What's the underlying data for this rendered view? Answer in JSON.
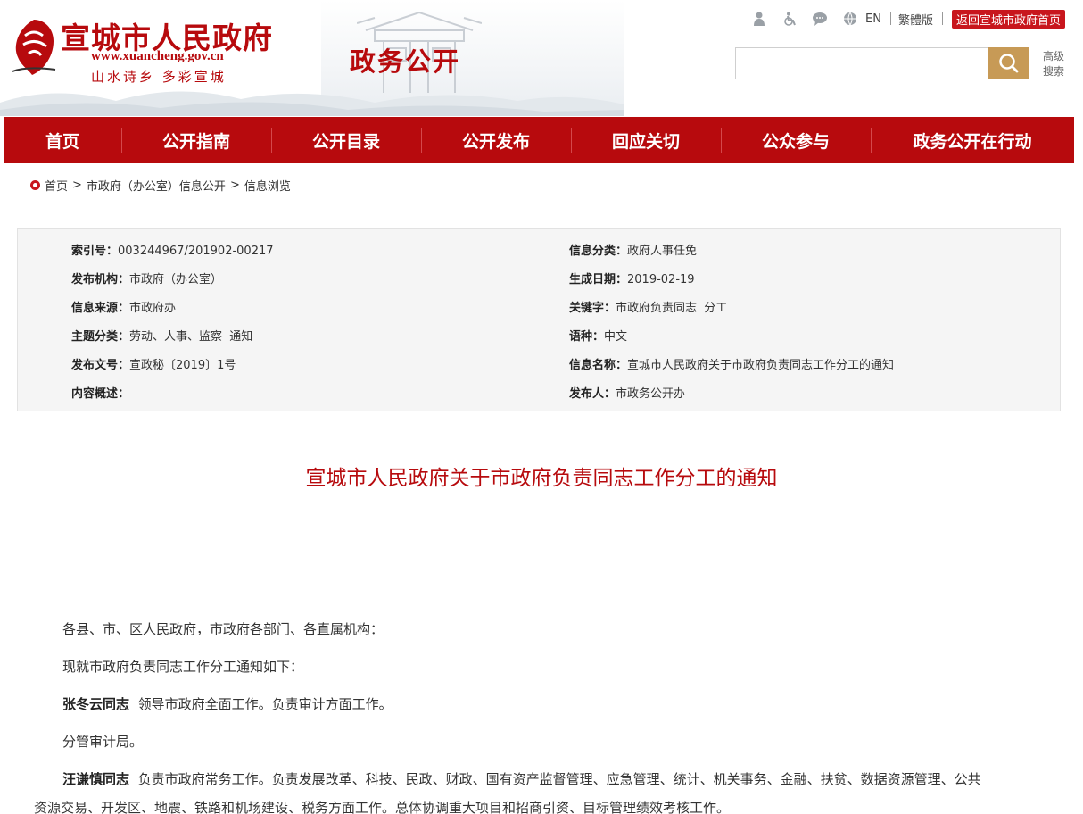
{
  "header": {
    "site_title": "宣城市人民政府",
    "site_url": "www.xuancheng.gov.cn",
    "slogan": "山水诗乡 多彩宣城",
    "section_title": "政务公开",
    "tools": {
      "lang_en": "EN",
      "traditional": "繁體版",
      "home_link": "返回宣城市政府首页"
    },
    "search": {
      "placeholder": "",
      "advanced": "高级搜索"
    }
  },
  "nav": {
    "items": [
      "首页",
      "公开指南",
      "公开目录",
      "公开发布",
      "回应关切",
      "公众参与",
      "政务公开在行动"
    ]
  },
  "breadcrumb": {
    "home": "首页",
    "level1": "市政府（办公室）信息公开",
    "level2": "信息浏览",
    "sep": ">"
  },
  "info": {
    "index_label": "索引号：",
    "index_value": "003244967/201902-00217",
    "category_label": "信息分类：",
    "category_value": "政府人事任免",
    "publisher_label": "发布机构：",
    "publisher_value": "市政府（办公室）",
    "date_label": "生成日期：",
    "date_value": "2019-02-19",
    "source_label": "信息来源：",
    "source_value": "市政府办",
    "keywords_label": "关键字：",
    "keywords_value": "市政府负责同志  分工",
    "topic_label": "主题分类：",
    "topic_value": "劳动、人事、监察  通知",
    "language_label": "语种：",
    "language_value": "中文",
    "docno_label": "发布文号：",
    "docno_value": "宣政秘〔2019〕1号",
    "name_label": "信息名称：",
    "name_value": "宣城市人民政府关于市政府负责同志工作分工的通知",
    "summary_label": "内容概述：",
    "summary_value": "",
    "issuer_label": "发布人：",
    "issuer_value": "市政务公开办"
  },
  "article": {
    "title": "宣城市人民政府关于市政府负责同志工作分工的通知",
    "p1": "各县、市、区人民政府，市政府各部门、各直属机构：",
    "p2": "现就市政府负责同志工作分工通知如下：",
    "p3_name": "张冬云同志",
    "p3_text": "领导市政府全面工作。负责审计方面工作。",
    "p4": "分管审计局。",
    "p5_name": "汪谦慎同志",
    "p5_text": "负责市政府常务工作。负责发展改革、科技、民政、财政、国有资产监督管理、应急管理、统计、机关事务、金融、扶贫、数据资源管理、公共",
    "p5_cont": "资源交易、开发区、地震、铁路和机场建设、税务方面工作。总体协调重大项目和招商引资、目标管理绩效考核工作。"
  },
  "colors": {
    "brand_red": "#b70a0d",
    "search_gold": "#c79a56",
    "info_bg": "#f5f5f5"
  }
}
